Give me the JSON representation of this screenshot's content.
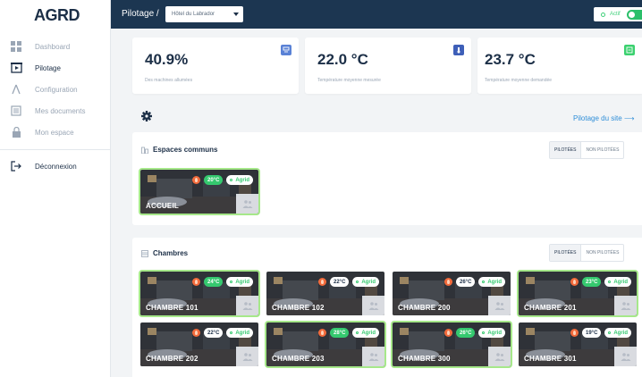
{
  "app": {
    "logo": "AGRD"
  },
  "sidebar": {
    "items": [
      {
        "label": "Dashboard",
        "icon": "dashboard-icon",
        "active": false
      },
      {
        "label": "Pilotage",
        "icon": "play-icon",
        "active": true
      },
      {
        "label": "Configuration",
        "icon": "tools-icon",
        "active": false
      },
      {
        "label": "Mes documents",
        "icon": "documents-icon",
        "active": false
      },
      {
        "label": "Mon espace",
        "icon": "lock-icon",
        "active": false
      }
    ],
    "logout": "Déconnexion"
  },
  "topbar": {
    "title": "Pilotage /",
    "site_select": "Hôtel du Labrador",
    "status_label": "Actif"
  },
  "stats": [
    {
      "value": "40.9%",
      "label": "Des machines allumées",
      "badge_color": "#5a82d6"
    },
    {
      "value": "22.0 °C",
      "label": "Température moyenne mesurée",
      "badge_color": "#3e5fb8"
    },
    {
      "value": "23.7 °C",
      "label": "Température moyenne demandée",
      "badge_color": "#3bd16f"
    }
  ],
  "site_link": "Pilotage du site",
  "sections": {
    "common": {
      "title": "Espaces communs",
      "seg_on": "PILOTÉES",
      "seg_off": "NON PILOTÉES",
      "rooms": [
        {
          "name": "ACCUEIL",
          "temp": "20°C",
          "agrid": "Agrid",
          "temp_style": "green",
          "highlight": true
        }
      ]
    },
    "rooms": {
      "title": "Chambres",
      "seg_on": "PILOTÉES",
      "seg_off": "NON PILOTÉES",
      "rooms": [
        {
          "name": "CHAMBRE 101",
          "temp": "24°C",
          "agrid": "Agrid",
          "temp_style": "green",
          "highlight": true
        },
        {
          "name": "CHAMBRE 102",
          "temp": "22°C",
          "agrid": "Agrid",
          "temp_style": "white",
          "highlight": false
        },
        {
          "name": "CHAMBRE 200",
          "temp": "26°C",
          "agrid": "Agrid",
          "temp_style": "white",
          "highlight": false
        },
        {
          "name": "CHAMBRE 201",
          "temp": "23°C",
          "agrid": "Agrid",
          "temp_style": "green",
          "highlight": true
        },
        {
          "name": "CHAMBRE 202",
          "temp": "22°C",
          "agrid": "Agrid",
          "temp_style": "white",
          "highlight": false
        },
        {
          "name": "CHAMBRE 203",
          "temp": "28°C",
          "agrid": "Agrid",
          "temp_style": "green",
          "highlight": true
        },
        {
          "name": "CHAMBRE 300",
          "temp": "26°C",
          "agrid": "Agrid",
          "temp_style": "green",
          "highlight": true
        },
        {
          "name": "CHAMBRE 301",
          "temp": "19°C",
          "agrid": "Agrid",
          "temp_style": "white",
          "highlight": false
        }
      ]
    }
  },
  "colors": {
    "accent": "#2f8ed8",
    "topbar": "#1c3651",
    "success": "#35c96f",
    "heat": "#f26a3b"
  }
}
